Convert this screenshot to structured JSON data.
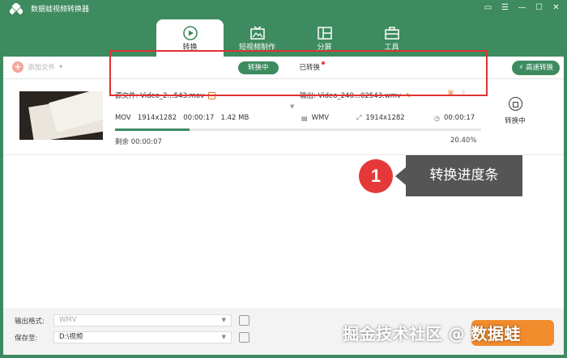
{
  "app": {
    "title": "数据蛙视频转换器"
  },
  "tabs": [
    {
      "label": "转换",
      "icon": "convert-icon",
      "active": true
    },
    {
      "label": "短视频制作",
      "icon": "tv-icon",
      "active": false
    },
    {
      "label": "分屏",
      "icon": "split-screen-icon",
      "active": false
    },
    {
      "label": "工具",
      "icon": "toolbox-icon",
      "active": false
    }
  ],
  "toolbar": {
    "add_file": "添加文件",
    "converting": "转换中",
    "converted": "已转换",
    "speed": "高速转换"
  },
  "file": {
    "source_label": "源文件:",
    "source_name": "Video_2...543.mov",
    "output_label": "输出:",
    "output_name": "Video_240...02543.wmv",
    "src_format": "MOV",
    "src_resolution": "1914x1282",
    "src_duration": "00:00:17",
    "src_size": "1.42 MB",
    "out_format": "WMV",
    "out_resolution": "1914x1282",
    "out_duration": "00:00:17",
    "remaining_label": "剩余",
    "remaining_time": "00:00:07",
    "progress_text": "20.40%",
    "progress": 0.204,
    "status": "转换中"
  },
  "callout": {
    "number": "1",
    "text": "转换进度条"
  },
  "bottom": {
    "format_label": "输出格式:",
    "format_value": "WMV",
    "save_label": "保存至:",
    "save_path": "D:\\视频"
  },
  "watermark": "掘金技术社区 @ 数据蛙",
  "colors": {
    "brand": "#3d8b5f",
    "accent": "#f28b2c",
    "highlight": "#e03232"
  }
}
